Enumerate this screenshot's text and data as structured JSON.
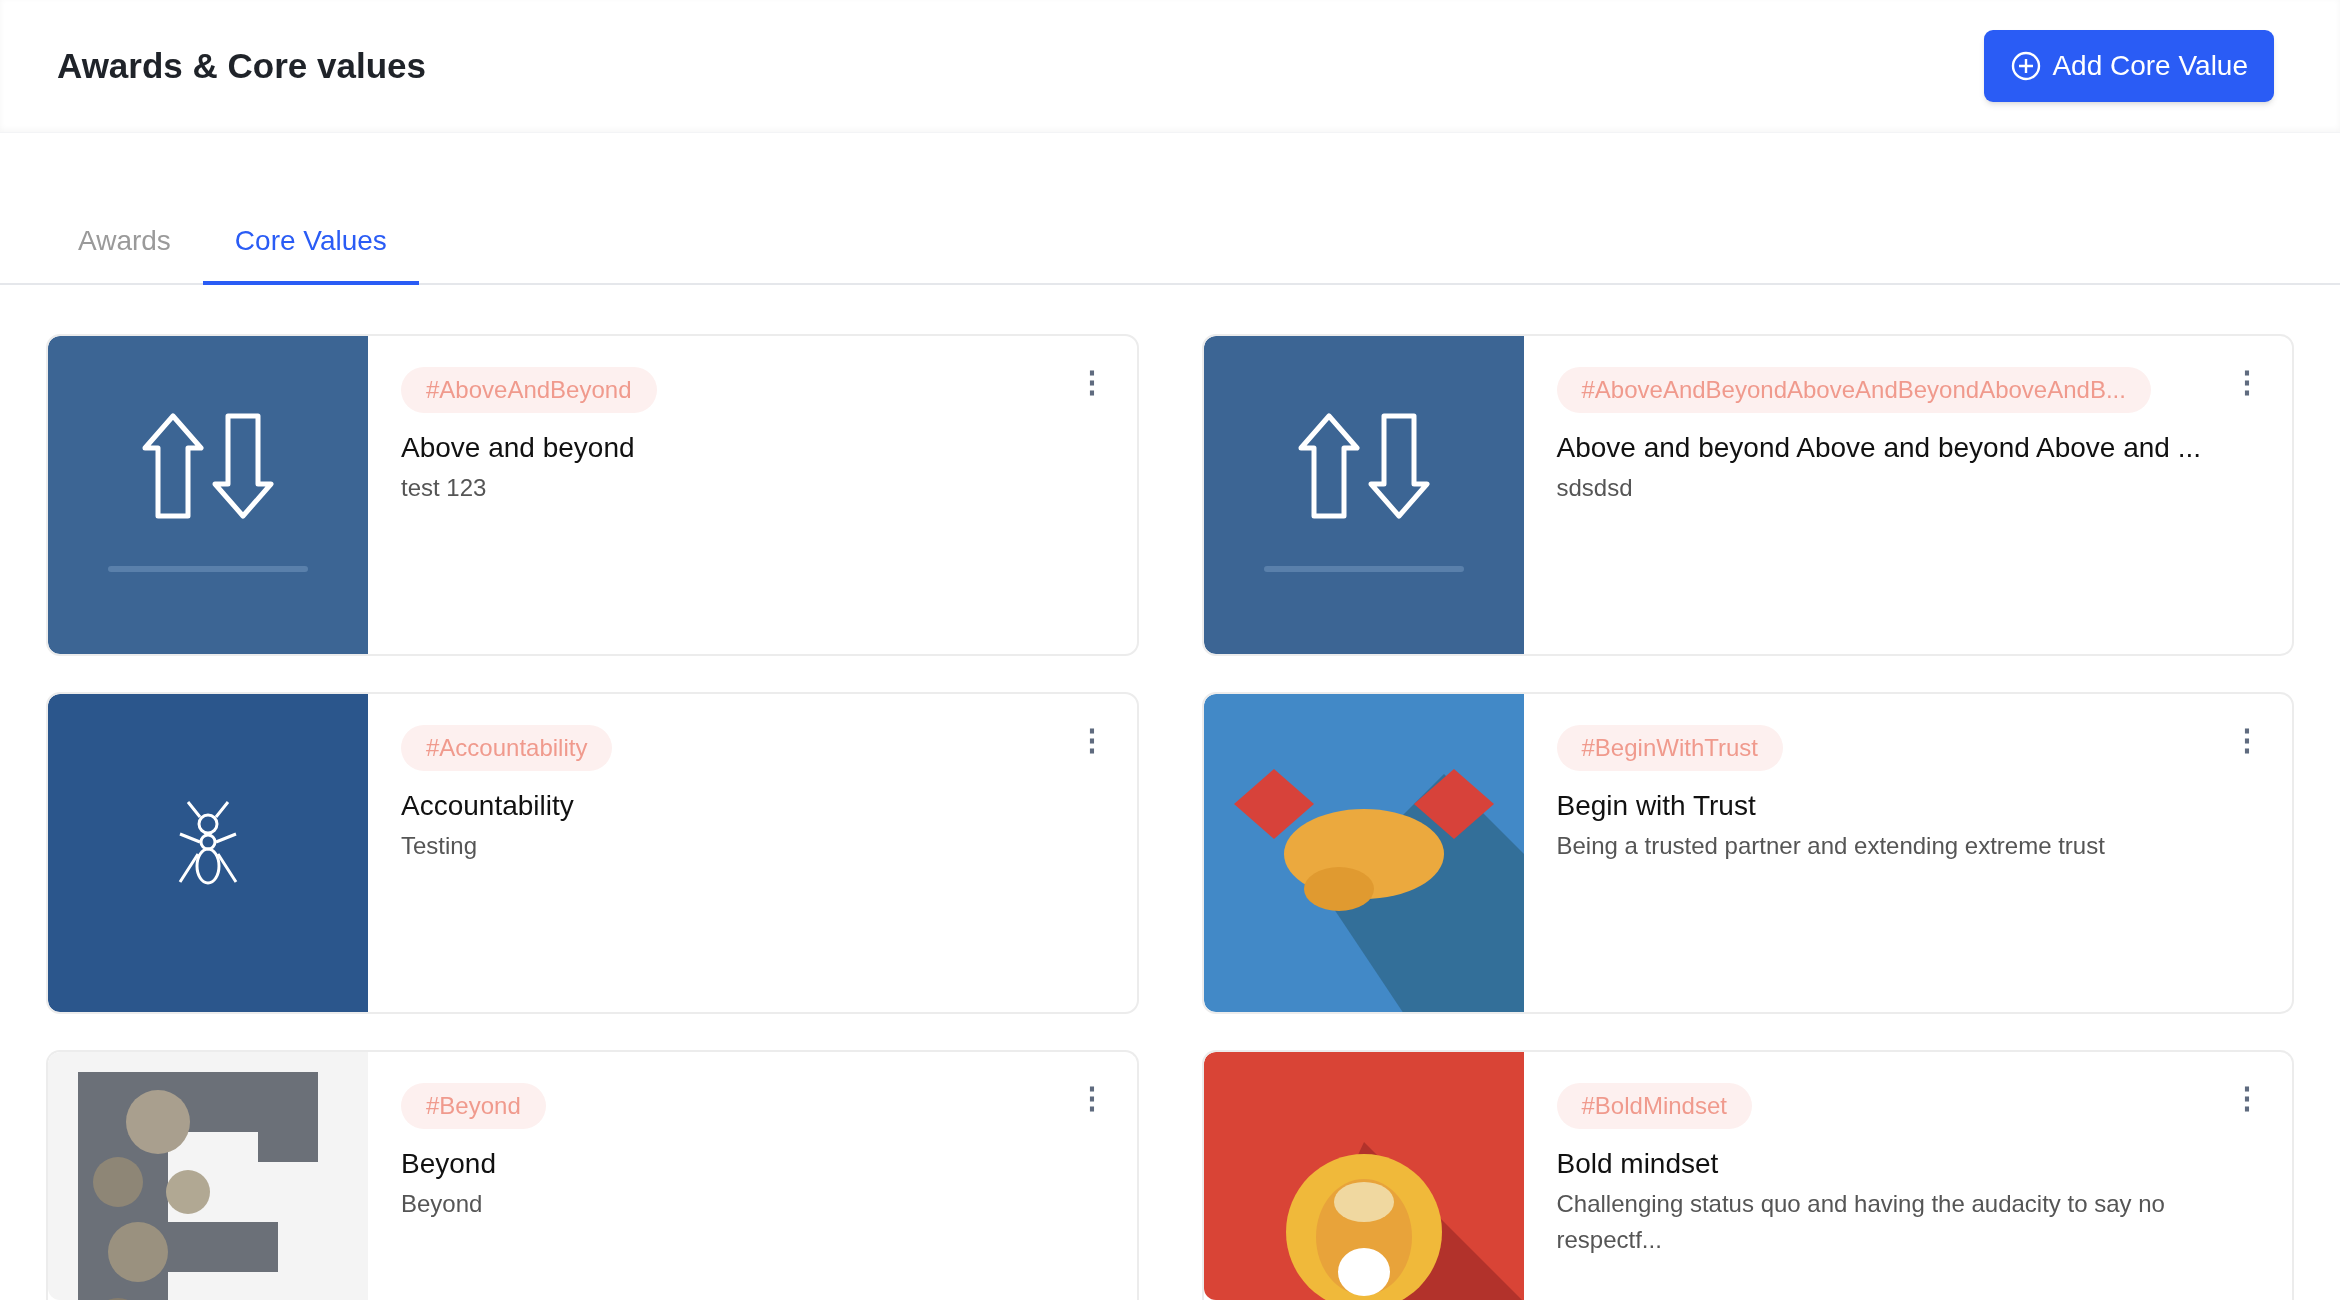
{
  "header": {
    "title": "Awards & Core values",
    "add_button": "Add Core Value"
  },
  "tabs": [
    {
      "label": "Awards",
      "selected": false
    },
    {
      "label": "Core Values",
      "selected": true
    }
  ],
  "cards": [
    {
      "tag": "#AboveAndBeyond",
      "title": "Above and beyond",
      "description": "test 123",
      "menu": "⋮"
    },
    {
      "tag": "#AboveAndBeyondAboveAndBeyondAboveAndB...",
      "title": "Above and beyond Above and beyond Above and ...",
      "description": "sdsdsd",
      "menu": "⋮"
    },
    {
      "tag": "#Accountability",
      "title": "Accountability",
      "description": "Testing",
      "menu": "⋮"
    },
    {
      "tag": "#BeginWithTrust",
      "title": "Begin with Trust",
      "description": "Being a trusted partner and extending extreme trust",
      "menu": "⋮"
    },
    {
      "tag": "#Beyond",
      "title": "Beyond",
      "description": "Beyond",
      "menu": "⋮"
    },
    {
      "tag": "#BoldMindset",
      "title": "Bold mindset",
      "description": "Challenging status quo and having the audacity to say no respectf...",
      "menu": "⋮"
    }
  ]
}
